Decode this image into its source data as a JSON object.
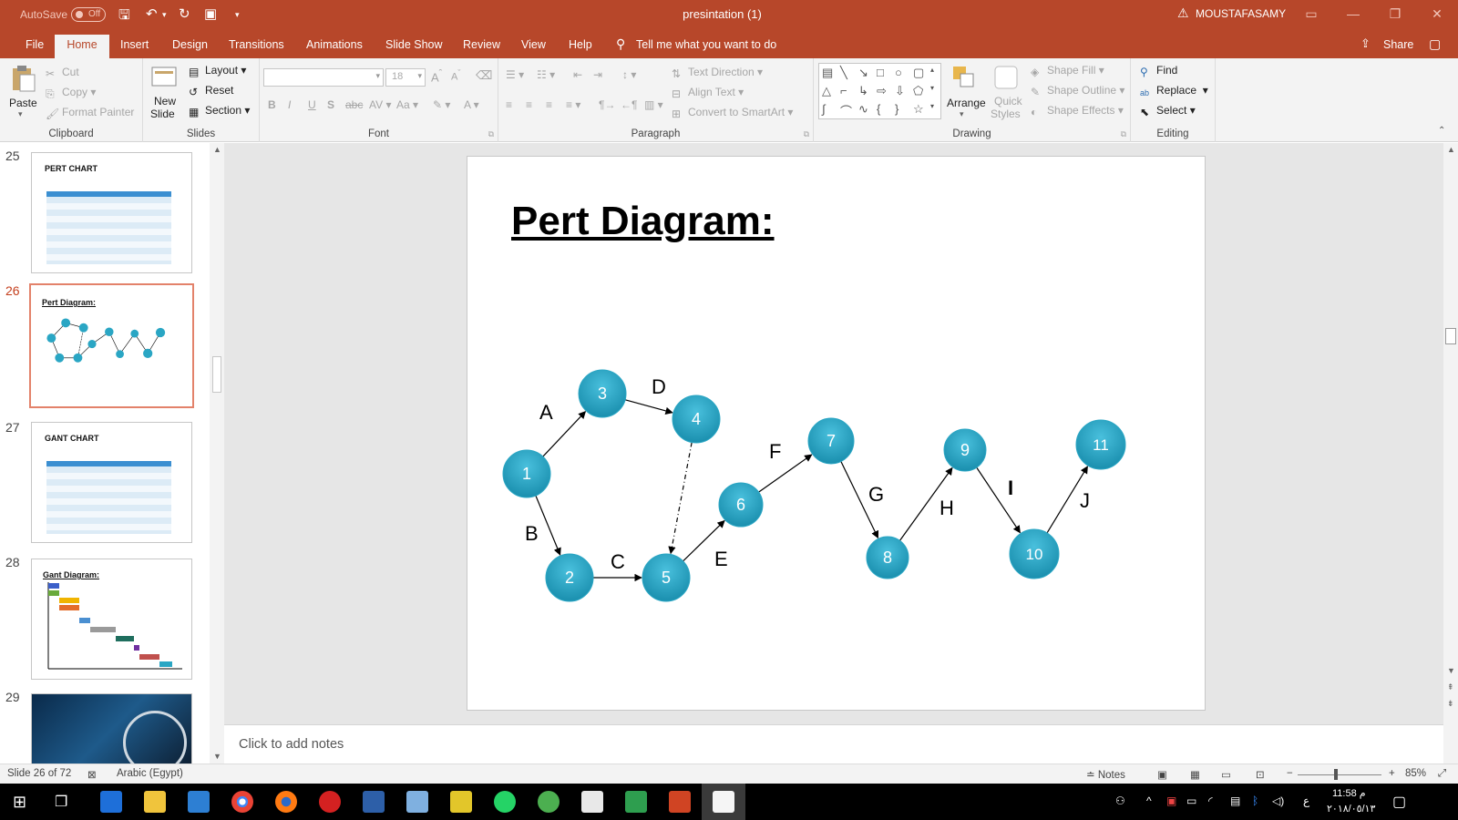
{
  "titlebar": {
    "autosave_label": "AutoSave",
    "autosave_state": "Off",
    "doc_title": "presintation (1)",
    "user": "MOUSTAFASAMY"
  },
  "tabs": [
    "File",
    "Home",
    "Insert",
    "Design",
    "Transitions",
    "Animations",
    "Slide Show",
    "Review",
    "View",
    "Help"
  ],
  "active_tab": "Home",
  "tell_me": "Tell me what you want to do",
  "share_label": "Share",
  "ribbon": {
    "clipboard": {
      "paste": "Paste",
      "cut": "Cut",
      "copy": "Copy",
      "format_painter": "Format Painter",
      "label": "Clipboard"
    },
    "slides": {
      "new_slide_1": "New",
      "new_slide_2": "Slide",
      "layout": "Layout",
      "reset": "Reset",
      "section": "Section",
      "label": "Slides"
    },
    "font": {
      "size": "18",
      "label": "Font"
    },
    "paragraph": {
      "text_direction": "Text Direction",
      "align_text": "Align Text",
      "convert_smartart": "Convert to SmartArt",
      "label": "Paragraph"
    },
    "drawing": {
      "arrange": "Arrange",
      "quick_styles_1": "Quick",
      "quick_styles_2": "Styles",
      "shape_fill": "Shape Fill",
      "shape_outline": "Shape Outline",
      "shape_effects": "Shape Effects",
      "label": "Drawing"
    },
    "editing": {
      "find": "Find",
      "replace": "Replace",
      "select": "Select",
      "label": "Editing"
    }
  },
  "thumbnails": [
    {
      "num": "25",
      "title": "PERT CHART",
      "kind": "table"
    },
    {
      "num": "26",
      "title": "Pert Diagram:",
      "kind": "diagram",
      "active": true
    },
    {
      "num": "27",
      "title": "GANT CHART",
      "kind": "table"
    },
    {
      "num": "28",
      "title": "Gant Diagram:",
      "kind": "gantt"
    },
    {
      "num": "29",
      "title": "",
      "kind": "image"
    }
  ],
  "slide": {
    "title": "Pert Diagram:",
    "nodes": [
      "1",
      "2",
      "3",
      "4",
      "5",
      "6",
      "7",
      "8",
      "9",
      "10",
      "11"
    ],
    "edges": [
      {
        "from": "1",
        "to": "3",
        "label": "A"
      },
      {
        "from": "1",
        "to": "2",
        "label": "B"
      },
      {
        "from": "2",
        "to": "5",
        "label": "C"
      },
      {
        "from": "3",
        "to": "4",
        "label": "D"
      },
      {
        "from": "4",
        "to": "5",
        "label": "",
        "dashed": true
      },
      {
        "from": "5",
        "to": "6",
        "label": "E"
      },
      {
        "from": "6",
        "to": "7",
        "label": "F"
      },
      {
        "from": "7",
        "to": "8",
        "label": "G"
      },
      {
        "from": "8",
        "to": "9",
        "label": "H"
      },
      {
        "from": "9",
        "to": "10",
        "label": "I"
      },
      {
        "from": "10",
        "to": "11",
        "label": "J"
      }
    ],
    "node_color": "#2aa6c4"
  },
  "notes_placeholder": "Click to add notes",
  "status": {
    "slide_info": "Slide 26 of 72",
    "language": "Arabic (Egypt)",
    "notes": "Notes",
    "zoom": "85%"
  },
  "taskbar": {
    "time": "11:58 م",
    "date": "٢٠١٨/٠٥/١٣",
    "lang": "ع"
  }
}
